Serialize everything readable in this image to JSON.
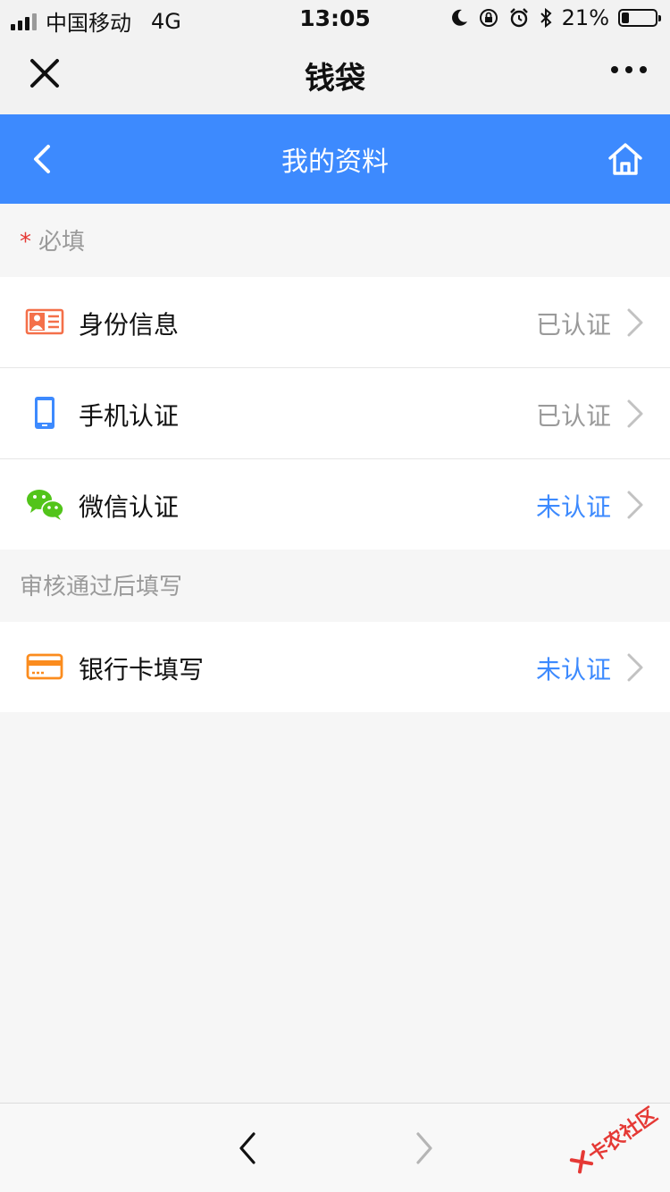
{
  "status_bar": {
    "carrier": "中国移动",
    "network": "4G",
    "time": "13:05",
    "battery_percent": "21%",
    "battery_level": 0.21
  },
  "title_bar": {
    "title": "钱袋",
    "close_icon": "close-icon",
    "more_icon": "more-icon"
  },
  "header": {
    "title": "我的资料",
    "back_icon": "chevron-left-icon",
    "home_icon": "home-icon",
    "color": "#3d8afe"
  },
  "sections": {
    "required": {
      "star": "*",
      "label": "必填",
      "items": [
        {
          "label": "身份信息",
          "status": "已认证",
          "icon": "id-card-icon"
        },
        {
          "label": "手机认证",
          "status": "已认证",
          "icon": "phone-icon"
        },
        {
          "label": "微信认证",
          "status": "未认证",
          "icon": "wechat-icon"
        }
      ]
    },
    "after_review": {
      "label": "审核通过后填写",
      "items": [
        {
          "label": "银行卡填写",
          "status": "未认证",
          "icon": "bank-card-icon"
        }
      ]
    }
  },
  "watermark": {
    "text": "卡农社区"
  },
  "colors": {
    "accent": "#3d8afe",
    "verified_status": "#9a9a9a",
    "unverified_status": "#3d8afe",
    "required_star": "#e53935"
  }
}
